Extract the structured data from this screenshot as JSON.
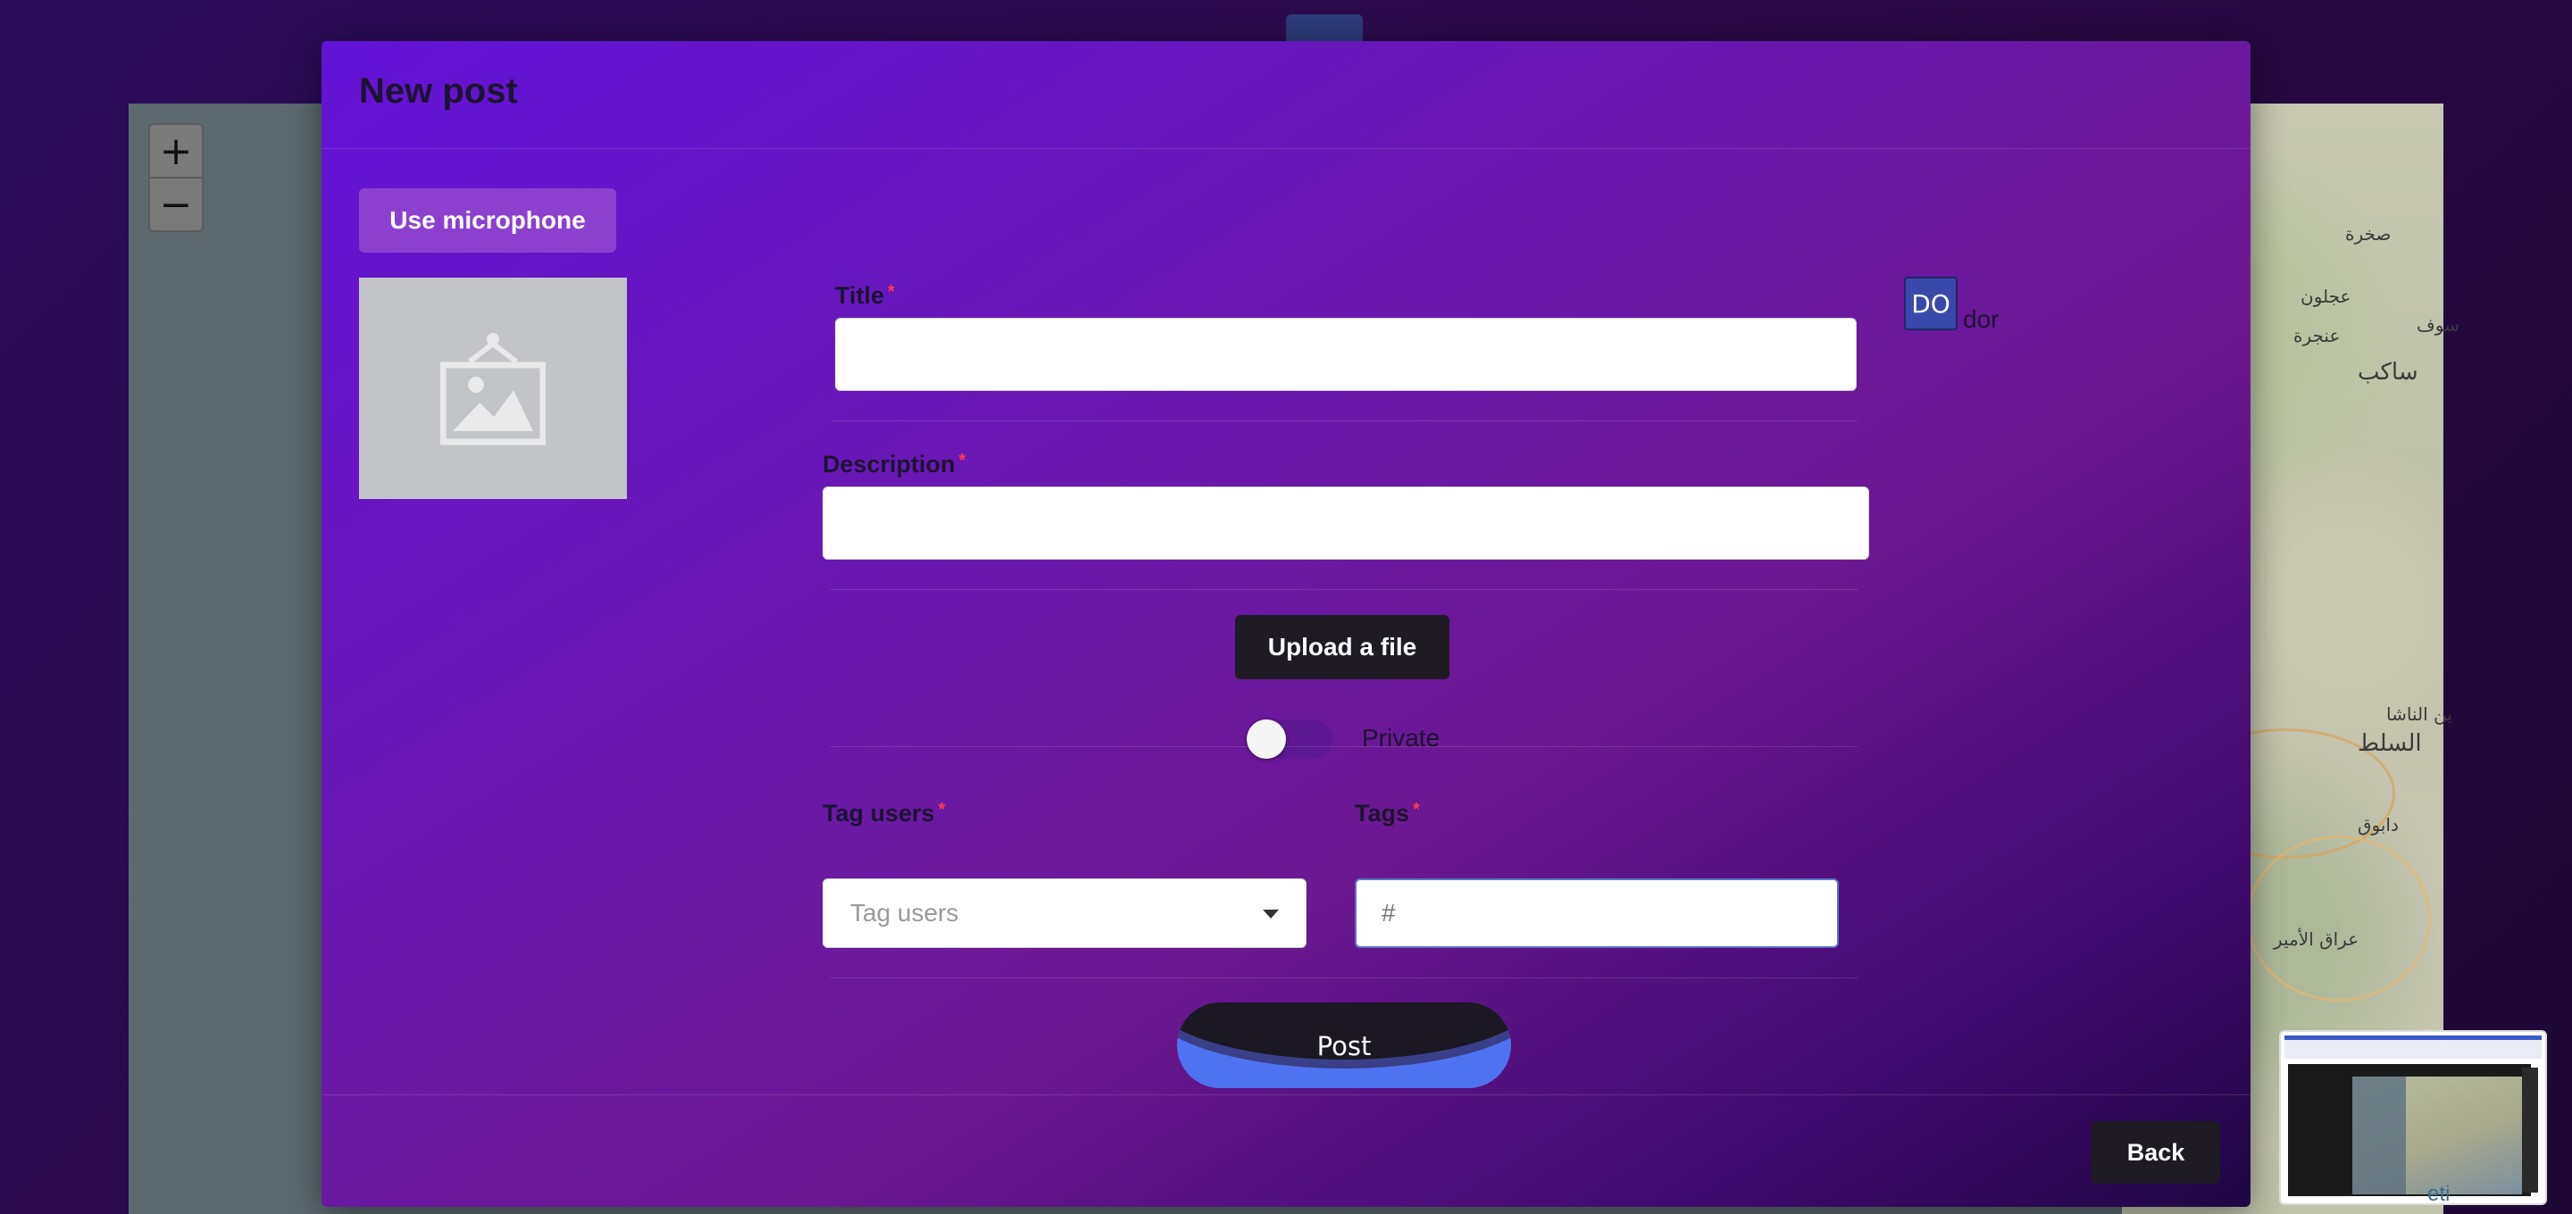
{
  "map": {
    "zoom_in_label": "+",
    "zoom_out_label": "−",
    "place_labels": [
      "صخرة",
      "عجلون",
      "عنجرة",
      "سوف",
      "ساكب",
      "ين الناشا",
      "السلط",
      "دابوق",
      "عراق الأمير"
    ],
    "attribution_fragment": "eti"
  },
  "modal": {
    "title": "New post",
    "mic_button_label": "Use microphone",
    "title_field": {
      "label": "Title",
      "required_mark": "*",
      "value": ""
    },
    "description_field": {
      "label": "Description",
      "required_mark": "*",
      "value": ""
    },
    "user": {
      "initials": "DO",
      "name": "dor"
    },
    "upload_button_label": "Upload a file",
    "private_toggle": {
      "label": "Private",
      "checked": false
    },
    "tag_users_field": {
      "label": "Tag users",
      "required_mark": "*",
      "placeholder": "Tag users"
    },
    "tags_field": {
      "label": "Tags",
      "required_mark": "*",
      "placeholder": "#"
    },
    "post_button_label": "Post",
    "back_button_label": "Back"
  },
  "colors": {
    "modal_gradient_start": "#6313d6",
    "modal_gradient_end": "#1e0744",
    "mic_button": "#8d3fd0",
    "dark_button": "#1f1b24",
    "post_accent": "#4e73f0",
    "avatar_badge": "#3949ab",
    "required_mark": "#ff3b4a"
  },
  "icons": {
    "image_placeholder": "image-icon",
    "select_caret": "chevron-down-icon"
  }
}
